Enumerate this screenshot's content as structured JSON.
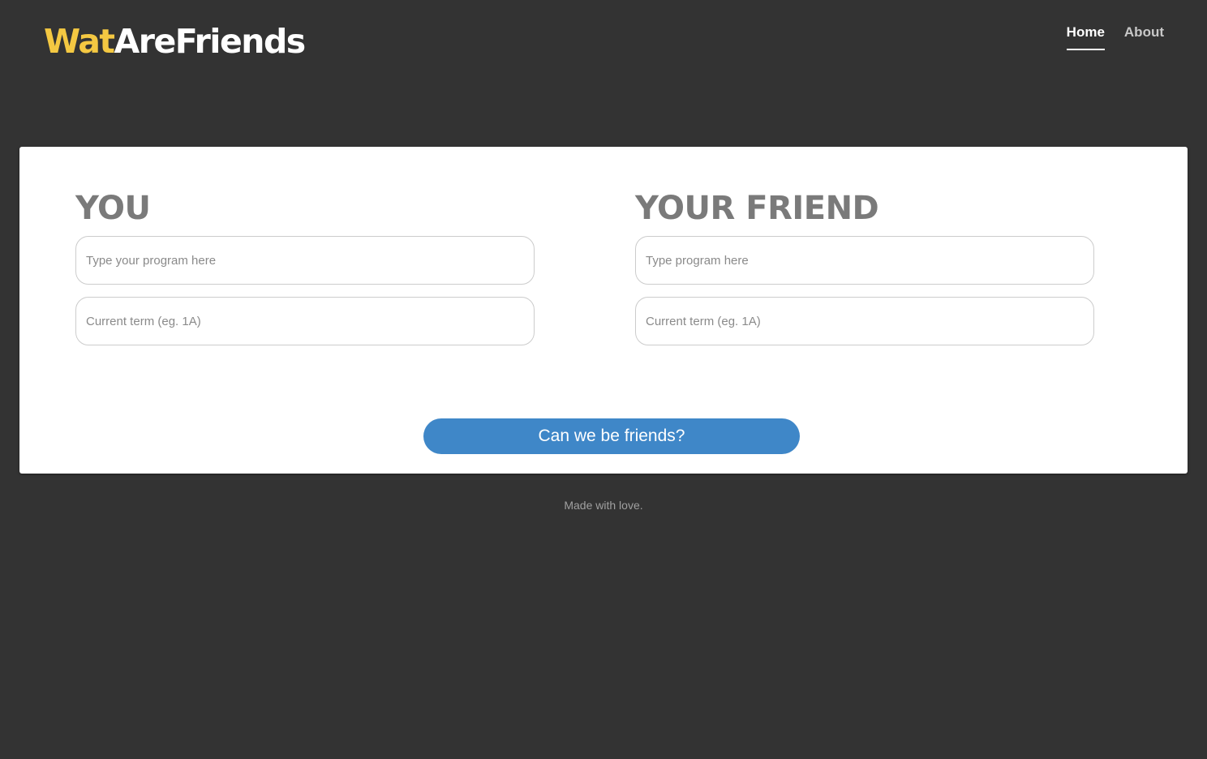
{
  "header": {
    "logo_accent": "Wat",
    "logo_main": "AreFriends",
    "nav": [
      {
        "label": "Home",
        "active": true
      },
      {
        "label": "About",
        "active": false
      }
    ]
  },
  "form": {
    "you": {
      "heading": "YOU",
      "program_placeholder": "Type your program here",
      "term_placeholder": "Current term (eg. 1A)"
    },
    "friend": {
      "heading": "YOUR FRIEND",
      "program_placeholder": "Type program here",
      "term_placeholder": "Current term (eg. 1A)"
    },
    "submit_label": "Can we be friends?"
  },
  "footer": {
    "text": "Made with love."
  },
  "colors": {
    "background": "#333333",
    "logo_accent": "#f4c842",
    "button": "#3f87c8",
    "heading": "#7a7a7a"
  }
}
